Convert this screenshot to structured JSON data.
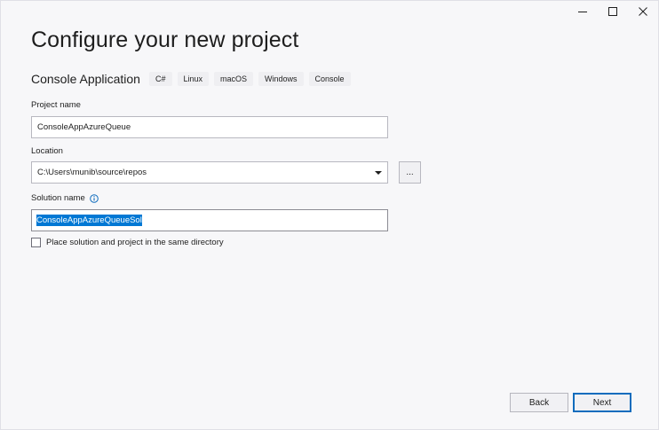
{
  "window": {
    "minimize_icon": "minimize-icon",
    "maximize_icon": "maximize-icon",
    "close_icon": "close-icon"
  },
  "header": {
    "title": "Configure your new project"
  },
  "template": {
    "name": "Console Application",
    "tags": [
      "C#",
      "Linux",
      "macOS",
      "Windows",
      "Console"
    ]
  },
  "project_name": {
    "label": "Project name",
    "value": "ConsoleAppAzureQueue"
  },
  "location": {
    "label": "Location",
    "value": "C:\\Users\\munib\\source\\repos",
    "browse_label": "..."
  },
  "solution_name": {
    "label": "Solution name",
    "info_icon": "info-icon",
    "value": "ConsoleAppAzureQueueSol"
  },
  "same_directory": {
    "label": "Place solution and project in the same directory",
    "checked": false
  },
  "footer": {
    "back_label": "Back",
    "next_label": "Next"
  },
  "colors": {
    "accent": "#0078d4",
    "primary_border": "#0f6cbd",
    "background": "#f7f7f9"
  }
}
